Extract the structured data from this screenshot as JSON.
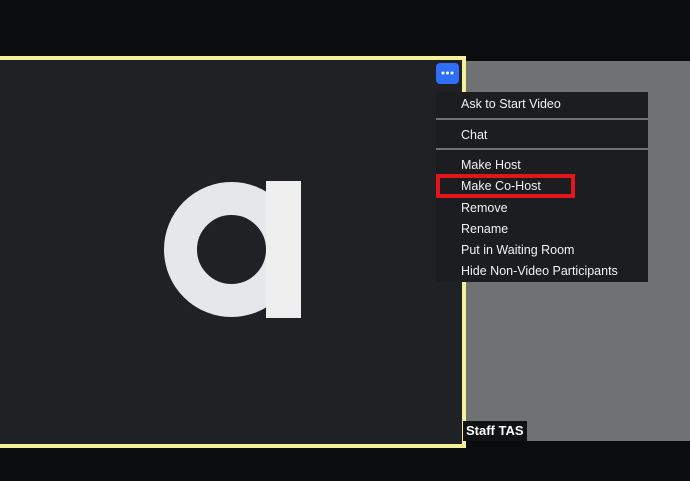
{
  "participant": {
    "name": "Staff TAS",
    "more_button_icon": "ellipsis-icon",
    "avatar_icon": "letter-a-logo-icon"
  },
  "context_menu": {
    "items": [
      {
        "label": "Ask to Start Video"
      },
      {
        "label": "Chat"
      },
      {
        "label": "Make Host"
      },
      {
        "label": "Make Co-Host",
        "highlighted": true
      },
      {
        "label": "Remove"
      },
      {
        "label": "Rename"
      },
      {
        "label": "Put in Waiting Room"
      },
      {
        "label": "Hide Non-Video Participants"
      }
    ]
  },
  "colors": {
    "active_speaker_border": "#f3f29a",
    "highlight": "#e2161a",
    "accent": "#2f6ef6"
  }
}
